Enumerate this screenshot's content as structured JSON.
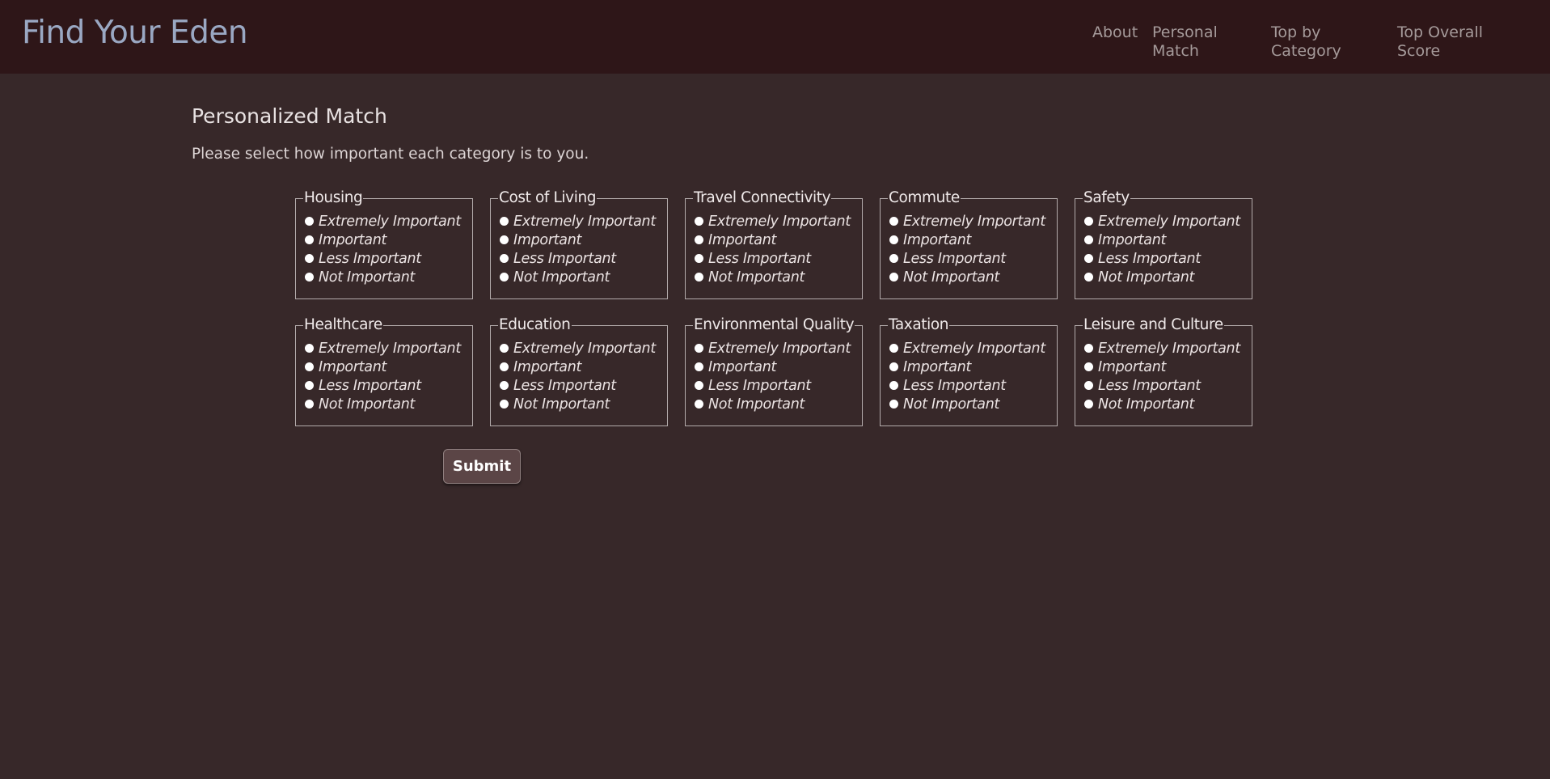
{
  "header": {
    "brand": "Find Your Eden",
    "nav": [
      {
        "line1": "About",
        "line2": ""
      },
      {
        "line1": "Personal",
        "line2": "Match"
      },
      {
        "line1": "Top by",
        "line2": "Category"
      },
      {
        "line1": "Top Overall",
        "line2": "Score"
      }
    ]
  },
  "main": {
    "title": "Personalized Match",
    "intro": "Please select how important each category is to you.",
    "options": [
      "Extremely Important",
      "Important",
      "Less Important",
      "Not Important"
    ],
    "categories": [
      "Housing",
      "Cost of Living",
      "Travel Connectivity",
      "Commute",
      "Safety",
      "Healthcare",
      "Education",
      "Environmental Quality",
      "Taxation",
      "Leisure and Culture"
    ],
    "submit_label": "Submit"
  }
}
